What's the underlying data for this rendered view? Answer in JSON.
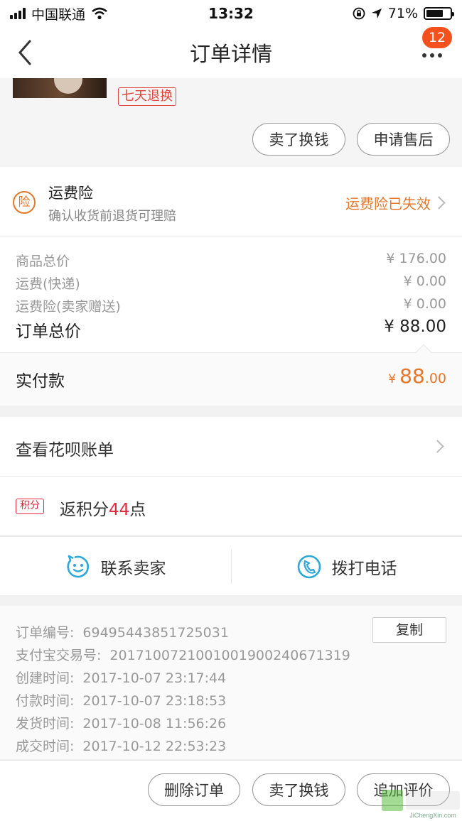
{
  "status_bar": {
    "carrier": "中国联通",
    "time": "13:32",
    "battery_percent": "71%",
    "battery_level": 0.71,
    "icons": [
      "signal-icon",
      "wifi-icon",
      "rotation-lock-icon",
      "location-arrow-icon",
      "battery-icon"
    ]
  },
  "nav": {
    "title": "订单详情",
    "badge_count": "12",
    "icons": [
      "back-chevron-icon",
      "more-dots-icon"
    ]
  },
  "product": {
    "tag": "七天退换",
    "actions": {
      "sell": "卖了换钱",
      "after_sale": "申请售后"
    }
  },
  "insurance": {
    "icon_char": "险",
    "title": "运费险",
    "subtitle": "确认收货前退货可理赔",
    "status": "运费险已失效"
  },
  "prices": {
    "goods_label": "商品总价",
    "goods_value": "¥ 176.00",
    "shipping_label": "运费(快递)",
    "shipping_value": "¥ 0.00",
    "insurance_label": "运费险(卖家赠送)",
    "insurance_value": "¥ 0.00",
    "total_label": "订单总价",
    "total_value": "¥ 88.00"
  },
  "payment": {
    "label": "实付款",
    "currency": "¥",
    "amount_int": "88",
    "amount_dec": ".00"
  },
  "huabei": {
    "label": "查看花呗账单"
  },
  "points": {
    "tag": "积分",
    "prefix": "返积分",
    "value": "44",
    "suffix": "点"
  },
  "contact": {
    "seller": "联系卖家",
    "call": "拨打电话"
  },
  "order_info": {
    "copy_label": "复制",
    "fields": [
      {
        "label": "订单编号:",
        "value": "69495443851725031"
      },
      {
        "label": "支付宝交易号:",
        "value": "2017100721001001900240671319"
      },
      {
        "label": "创建时间:",
        "value": "2017-10-07 23:17:44"
      },
      {
        "label": "付款时间:",
        "value": "2017-10-07 23:18:53"
      },
      {
        "label": "发货时间:",
        "value": "2017-10-08 11:56:26"
      },
      {
        "label": "成交时间:",
        "value": "2017-10-12 22:53:23"
      }
    ]
  },
  "bottom_actions": {
    "delete": "删除订单",
    "sell": "卖了换钱",
    "review": "追加评价"
  },
  "watermark": {
    "site": "JiChengXin.com"
  },
  "colors": {
    "accent_orange": "#e5772b",
    "badge_red": "#f4511e",
    "points_red": "#e0283e",
    "icon_blue": "#2ea8d8"
  }
}
